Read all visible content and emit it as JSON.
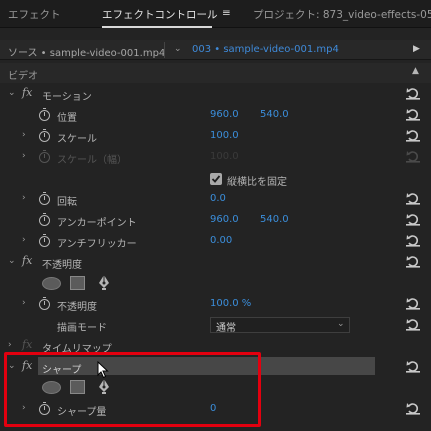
{
  "tabs": {
    "effects": "エフェクト",
    "effect_controls": "エフェクトコントロール",
    "menu_glyph": "≡",
    "project": "プロジェクト: 873_video-effects-05"
  },
  "source_bar": {
    "source_label": "ソース • sample-video-001.mp4",
    "sequence_label": "003 • sample-video-001.mp4"
  },
  "section_video": "ビデオ",
  "motion": {
    "name": "モーション",
    "position_label": "位置",
    "position_x": "960.0",
    "position_y": "540.0",
    "scale_label": "スケール",
    "scale_value": "100.0",
    "scale_width_label": "スケール（幅）",
    "scale_width_value": "100.0",
    "uniform_scale_label": "縦横比を固定",
    "rotation_label": "回転",
    "rotation_value": "0.0",
    "anchor_label": "アンカーポイント",
    "anchor_x": "960.0",
    "anchor_y": "540.0",
    "antiflicker_label": "アンチフリッカー",
    "antiflicker_value": "0.00"
  },
  "opacity": {
    "name": "不透明度",
    "opacity_label": "不透明度",
    "opacity_value": "100.0 %",
    "blend_label": "描画モード",
    "blend_value": "通常"
  },
  "time_remap": {
    "name": "タイムリマップ"
  },
  "sharpen": {
    "name": "シャープ",
    "amount_label": "シャープ量",
    "amount_value": "0"
  },
  "colors": {
    "value_blue": "#3b8edb",
    "highlight_red": "#e3000f"
  }
}
